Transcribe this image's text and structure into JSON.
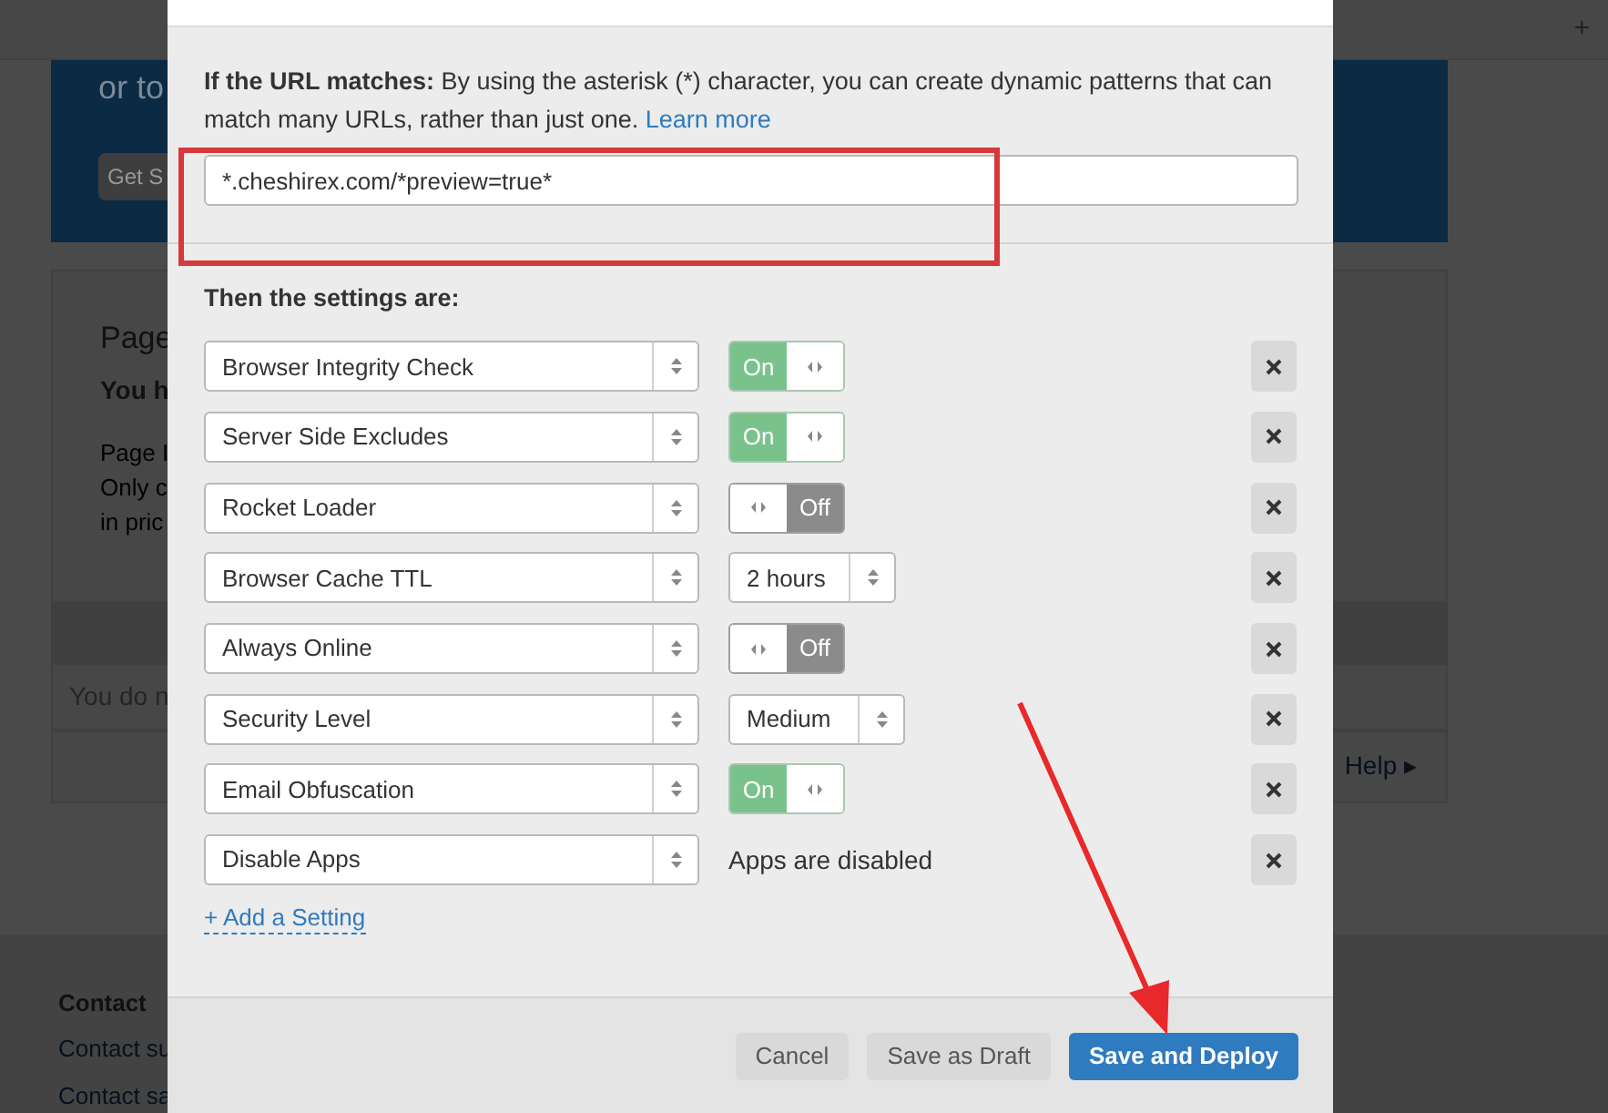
{
  "background_page": {
    "top_bar_icon": "+",
    "banner": {
      "text": "or to",
      "button": "Get S"
    },
    "card": {
      "title": "Page",
      "subtitle": "You h",
      "lines": [
        "Page I",
        "Only c",
        "in pric"
      ]
    },
    "notice": "You do n",
    "help_link": "Help ▸",
    "footer": {
      "heading": "Contact",
      "links": [
        "Contact su",
        "Contact sa"
      ]
    }
  },
  "modal": {
    "url_section": {
      "label": "If the URL matches:",
      "description": "By using the asterisk (*) character, you can create dynamic patterns that can match many URLs, rather than just one.",
      "link": "Learn more",
      "url_value": "*.cheshirex.com/*preview=true*"
    },
    "settings_heading": "Then the settings are:",
    "settings": [
      {
        "name": "Browser Integrity Check",
        "kind": "toggle",
        "on": true,
        "toggle_label": "On"
      },
      {
        "name": "Server Side Excludes",
        "kind": "toggle",
        "on": true,
        "toggle_label": "On"
      },
      {
        "name": "Rocket Loader",
        "kind": "toggle",
        "on": false,
        "toggle_label": "Off"
      },
      {
        "name": "Browser Cache TTL",
        "kind": "select",
        "value": "2 hours"
      },
      {
        "name": "Always Online",
        "kind": "toggle",
        "on": false,
        "toggle_label": "Off"
      },
      {
        "name": "Security Level",
        "kind": "select",
        "value": "Medium"
      },
      {
        "name": "Email Obfuscation",
        "kind": "toggle",
        "on": true,
        "toggle_label": "On"
      },
      {
        "name": "Disable Apps",
        "kind": "text",
        "value": "Apps are disabled"
      }
    ],
    "add_setting": "+ Add a Setting",
    "buttons": [
      {
        "label": "Cancel",
        "kind": "secondary"
      },
      {
        "label": "Save as Draft",
        "kind": "secondary"
      },
      {
        "label": "Save and Deploy",
        "kind": "primary"
      }
    ]
  }
}
